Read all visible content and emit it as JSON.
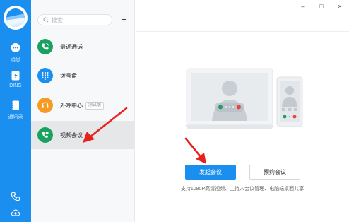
{
  "rail": {
    "items": [
      {
        "icon": "chat-icon",
        "label": "消息"
      },
      {
        "icon": "ding-icon",
        "label": "DING"
      },
      {
        "icon": "contacts-icon",
        "label": "通讯录"
      }
    ],
    "bottom_icons": [
      "phone-icon",
      "cloud-icon"
    ]
  },
  "search": {
    "placeholder": "搜索"
  },
  "list": {
    "items": [
      {
        "label": "最近通话",
        "icon": "phone-recent-icon",
        "color": "#19a15f"
      },
      {
        "label": "拨号盘",
        "icon": "dialpad-icon",
        "color": "#1b8ff0"
      },
      {
        "label": "外呼中心",
        "icon": "headset-icon",
        "color": "#f59a23",
        "tag": "测试版"
      },
      {
        "label": "视频会议",
        "icon": "video-call-icon",
        "color": "#19a15f"
      }
    ]
  },
  "content": {
    "primary_button": "发起会议",
    "secondary_button": "预约会议",
    "description": "支持1080P高清视频、主持人会议管理、电脑端桌面共享"
  },
  "window": {
    "minimize": "–",
    "maximize": "□",
    "close": "×"
  },
  "colors": {
    "accent": "#1b8ff0",
    "annotation": "#e8211d"
  }
}
